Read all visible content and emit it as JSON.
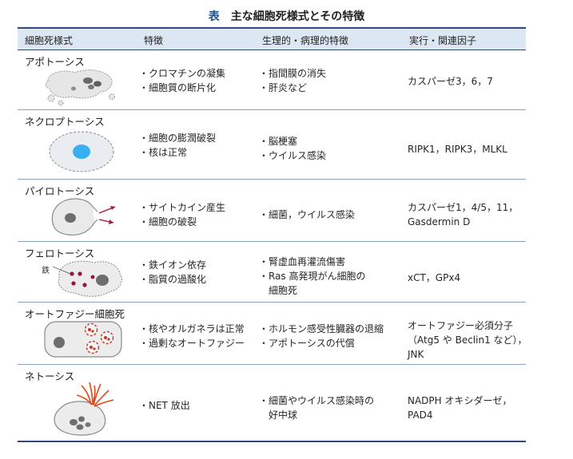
{
  "title": {
    "lead": "表",
    "text": "主な細胞死様式とその特徴"
  },
  "headers": [
    "細胞死様式",
    "特徴",
    "生理的・病理的特徴",
    "実行・関連因子"
  ],
  "rows": [
    {
      "name": "アポトーシス",
      "features": [
        "・クロマチンの凝集",
        "・細胞質の断片化"
      ],
      "physio": [
        "・指間膜の消失",
        "・肝炎など"
      ],
      "factors": [
        "カスパーゼ3，6，7"
      ]
    },
    {
      "name": "ネクロプトーシス",
      "features": [
        "・細胞の膨潤破裂",
        "・核は正常"
      ],
      "physio": [
        "・脳梗塞",
        "・ウイルス感染"
      ],
      "factors": [
        "RIPK1，RIPK3，MLKL"
      ]
    },
    {
      "name": "パイロトーシス",
      "features": [
        "・サイトカイン産生",
        "・細胞の破裂"
      ],
      "physio": [
        "・細菌，ウイルス感染"
      ],
      "factors": [
        "カスパーゼ1，4/5，11，",
        "Gasdermin D"
      ]
    },
    {
      "name": "フェロトーシス",
      "label": "鉄",
      "features": [
        "・鉄イオン依存",
        "・脂質の過酸化"
      ],
      "physio": [
        "・腎虚血再灌流傷害",
        "・Ras 高発現がん細胞の",
        "  細胞死"
      ],
      "factors": [
        "xCT，GPx4"
      ]
    },
    {
      "name": "オートファジー細胞死",
      "features": [
        "・核やオルガネラは正常",
        "・過剰なオートファジー"
      ],
      "physio": [
        "・ホルモン感受性臓器の退縮",
        "・アポトーシスの代償"
      ],
      "factors": [
        "オートファジー必須分子",
        "（Atg5 や Beclin1 など），",
        "JNK"
      ]
    },
    {
      "name": "ネトーシス",
      "features": [
        "・NET 放出"
      ],
      "physio": [
        "・細菌やウイルス感染時の",
        "  好中球"
      ],
      "factors": [
        "NADPH オキシダーゼ，",
        "PAD4"
      ]
    }
  ]
}
